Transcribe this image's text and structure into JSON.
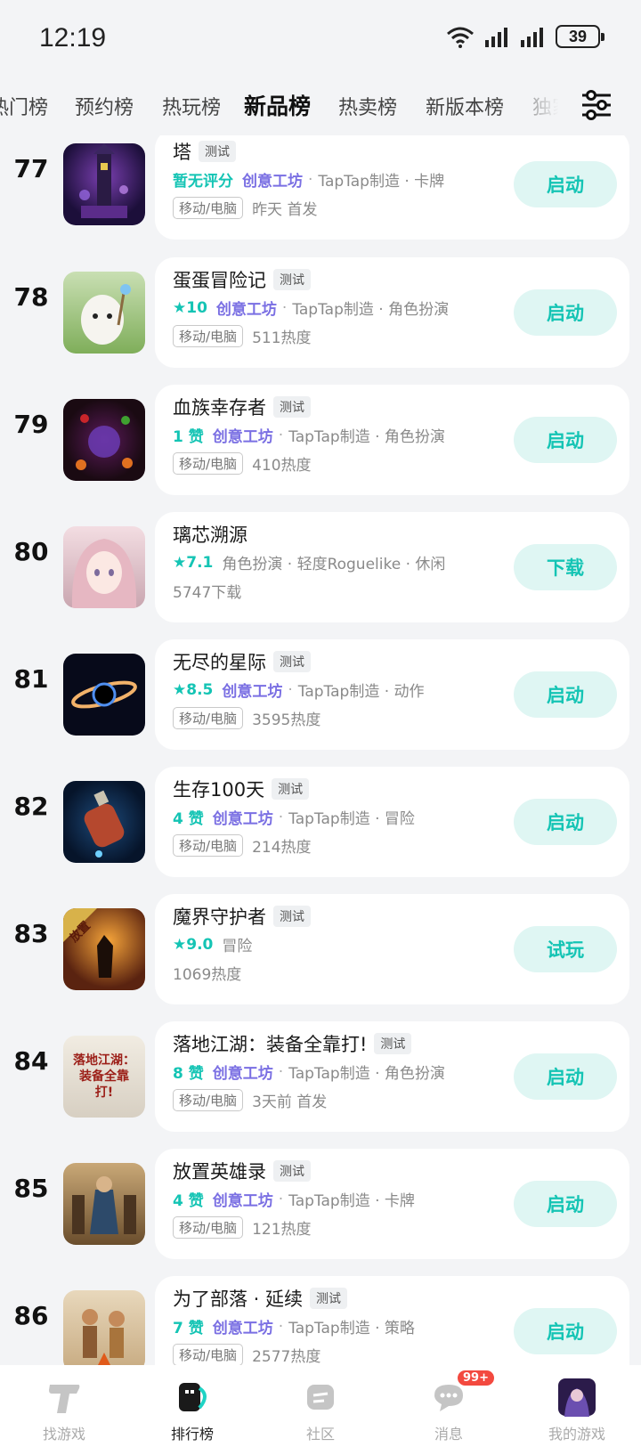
{
  "status": {
    "time": "12:19",
    "battery": "39"
  },
  "tabs": [
    "热门榜",
    "预约榜",
    "热玩榜",
    "新品榜",
    "热卖榜",
    "新版本榜",
    "独家"
  ],
  "items": [
    {
      "rank": "77",
      "title": "塔",
      "badge": "测试",
      "score": "暂无评分",
      "workshop": "创意工坊",
      "tags": "TapTap制造 · 卡牌",
      "platform": "移动/电脑",
      "info": "昨天 首发",
      "action": "启动"
    },
    {
      "rank": "78",
      "title": "蛋蛋冒险记",
      "badge": "测试",
      "score": "★10",
      "workshop": "创意工坊",
      "tags": "TapTap制造 · 角色扮演",
      "platform": "移动/电脑",
      "info": "511热度",
      "action": "启动"
    },
    {
      "rank": "79",
      "title": "血族幸存者",
      "badge": "测试",
      "score": "1 赞",
      "workshop": "创意工坊",
      "tags": "TapTap制造 · 角色扮演",
      "platform": "移动/电脑",
      "info": "410热度",
      "action": "启动"
    },
    {
      "rank": "80",
      "title": "璃芯溯源",
      "badge": "",
      "score": "★7.1",
      "workshop": "",
      "tags": "角色扮演 · 轻度Roguelike · 休闲",
      "platform": "",
      "info": "5747下载",
      "action": "下载"
    },
    {
      "rank": "81",
      "title": "无尽的星际",
      "badge": "测试",
      "score": "★8.5",
      "workshop": "创意工坊",
      "tags": "TapTap制造 · 动作",
      "platform": "移动/电脑",
      "info": "3595热度",
      "action": "启动"
    },
    {
      "rank": "82",
      "title": "生存100天",
      "badge": "测试",
      "score": "4 赞",
      "workshop": "创意工坊",
      "tags": "TapTap制造 · 冒险",
      "platform": "移动/电脑",
      "info": "214热度",
      "action": "启动"
    },
    {
      "rank": "83",
      "title": "魔界守护者",
      "badge": "测试",
      "score": "★9.0",
      "workshop": "",
      "tags": "冒险",
      "platform": "",
      "info": "1069热度",
      "action": "试玩"
    },
    {
      "rank": "84",
      "title": "落地江湖：装备全靠打!",
      "badge": "测试",
      "score": "8 赞",
      "workshop": "创意工坊",
      "tags": "TapTap制造 · 角色扮演",
      "platform": "移动/电脑",
      "info": "3天前 首发",
      "action": "启动"
    },
    {
      "rank": "85",
      "title": "放置英雄录",
      "badge": "测试",
      "score": "4 赞",
      "workshop": "创意工坊",
      "tags": "TapTap制造 · 卡牌",
      "platform": "移动/电脑",
      "info": "121热度",
      "action": "启动"
    },
    {
      "rank": "86",
      "title": "为了部落 · 延续",
      "badge": "测试",
      "score": "7 赞",
      "workshop": "创意工坊",
      "tags": "TapTap制造 · 策略",
      "platform": "移动/电脑",
      "info": "2577热度",
      "action": "启动"
    }
  ],
  "thumb_text": {
    "83": "放置",
    "84": "落地江湖：装备全靠打!"
  },
  "bottom_nav": [
    {
      "label": "找游戏",
      "icon": "taptap-logo-icon"
    },
    {
      "label": "排行榜",
      "icon": "ranking-icon"
    },
    {
      "label": "社区",
      "icon": "community-icon"
    },
    {
      "label": "消息",
      "icon": "message-icon",
      "badge": "99+"
    },
    {
      "label": "我的游戏",
      "icon": "my-games-avatar-icon"
    }
  ],
  "colors": {
    "accent": "#14c4b4",
    "workshop": "#7a6fe3",
    "button_bg": "#dff6f3",
    "badge_red": "#f3493f"
  }
}
